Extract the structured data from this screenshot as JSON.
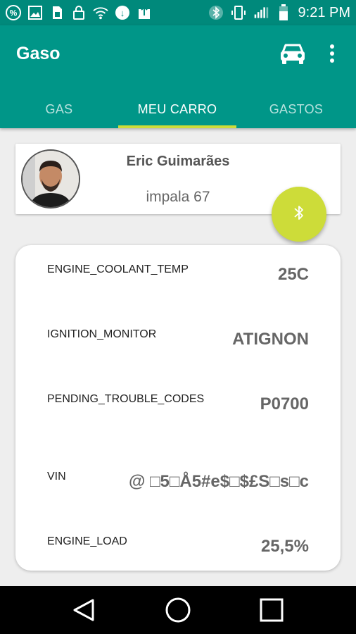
{
  "status_bar": {
    "time": "9:21 PM",
    "icons": [
      "percent-icon",
      "image-icon",
      "sim-card-icon",
      "lock-icon",
      "wifi-icon",
      "data-saver-icon",
      "upload-icon",
      "bluetooth-icon",
      "vibrate-icon",
      "signal-icon",
      "battery-icon"
    ]
  },
  "app_bar": {
    "title": "Gaso",
    "actions": [
      "car-icon",
      "more-vert-icon"
    ]
  },
  "tabs": [
    {
      "label": "GAS"
    },
    {
      "label": "MEU CARRO",
      "active": true
    },
    {
      "label": "GASTOS"
    }
  ],
  "profile": {
    "name": "Eric Guimarães",
    "car": "impala 67"
  },
  "fab": {
    "icon": "bluetooth-icon"
  },
  "obd_data": [
    {
      "key": "ENGINE_COOLANT_TEMP",
      "value": "25C"
    },
    {
      "key": "IGNITION_MONITOR",
      "value": "ATIGNON"
    },
    {
      "key": "PENDING_TROUBLE_CODES",
      "value": "P0700"
    },
    {
      "key": "VIN",
      "value": "@ □5□Å5#e$□$£S□s□c"
    },
    {
      "key": "ENGINE_LOAD",
      "value": "25,5%"
    }
  ],
  "nav_bar": {
    "buttons": [
      "back-icon",
      "home-icon",
      "recents-icon"
    ]
  },
  "colors": {
    "primary": "#009688",
    "primary_dark": "#00897b",
    "accent": "#cddc39"
  }
}
